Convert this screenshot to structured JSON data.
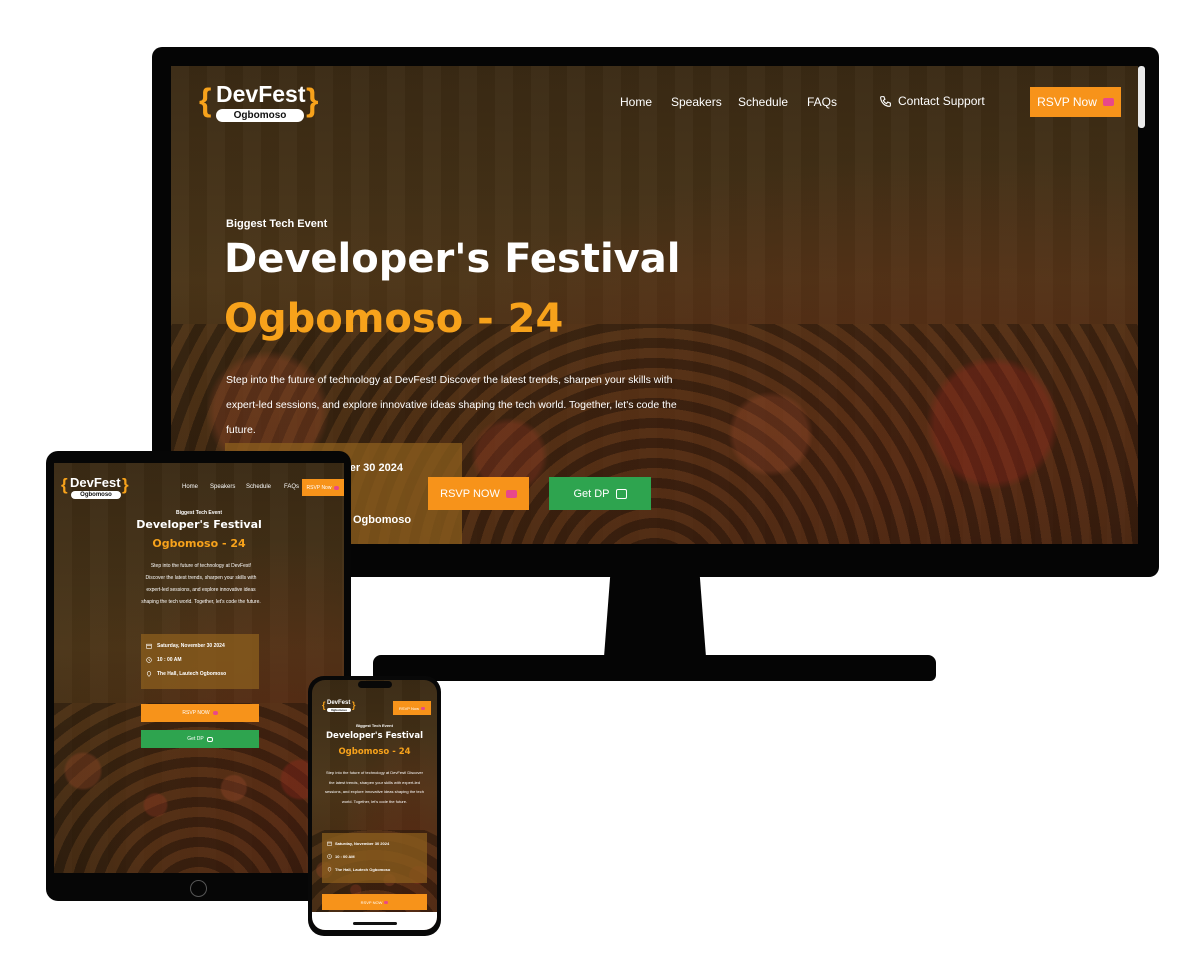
{
  "brand": {
    "name": "DevFest",
    "city": "Ogbomoso"
  },
  "nav": {
    "home": "Home",
    "speakers": "Speakers",
    "schedule": "Schedule",
    "faqs": "FAQs",
    "contact": "Contact Support",
    "rsvp": "RSVP Now"
  },
  "hero": {
    "eyebrow": "Biggest Tech Event",
    "title_line1": "Developer's Festival",
    "title_line2": "Ogbomoso - 24",
    "description": "Step into the future of technology at DevFest! Discover the latest trends, sharpen your skills with expert-led sessions, and explore innovative ideas shaping the tech world. Together, let's code the future.",
    "rsvp_button": "RSVP NOW",
    "getdp_button": "Get DP"
  },
  "event": {
    "date": "Saturday, November 30 2024",
    "time": "10 : 00 AM",
    "venue": "The Hall, Lautech Ogbomoso"
  },
  "monitor_partial": {
    "date_fragment": "ber 30 2024",
    "venue_fragment": "Ogbomoso"
  },
  "icons": [
    "phone-icon",
    "ticket-icon",
    "image-icon",
    "calendar-icon",
    "clock-icon",
    "location-pin-icon"
  ],
  "colors": {
    "accent": "#f7a21b",
    "button_orange": "#f7931a",
    "button_green": "#2ea44f"
  }
}
